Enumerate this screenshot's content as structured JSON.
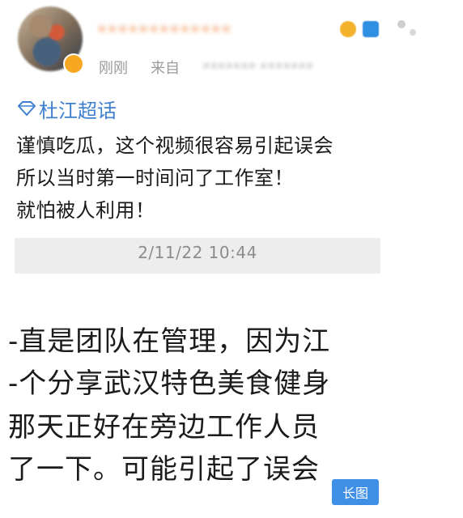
{
  "header": {
    "username": "•••••••••••••",
    "time": "刚刚",
    "source_label": "来自",
    "source": "••••••• •••••••"
  },
  "topic": {
    "icon": "super-topic-icon",
    "label": "杜江超话"
  },
  "post": {
    "lines": [
      "谨慎吃瓜，这个视频很容易引起误会",
      "所以当时第一时间问了工作室！",
      "就怕被人利用！"
    ]
  },
  "screenshot": {
    "timestamp": "2/11/22 10:44",
    "lines": [
      "-直是团队在管理，因为江",
      "-个分享武汉特色美食健身",
      "那天正好在旁边工作人员",
      "了一下。可能引起了误会"
    ],
    "badge": "长图"
  },
  "colors": {
    "topic": "#3e7fd0",
    "badge_bg": "#3f8fe6",
    "meta": "#9a9a9a"
  }
}
